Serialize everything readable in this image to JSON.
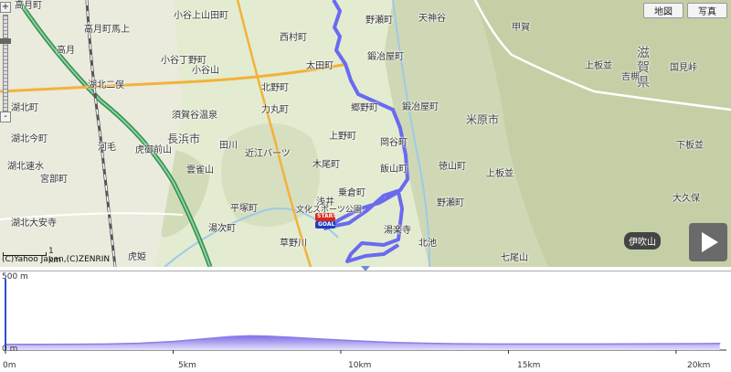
{
  "toolbar": {
    "map_label": "地図",
    "photo_label": "写真"
  },
  "map": {
    "copyright": "(C)Yahoo Japan,(C)ZENRIN",
    "scale_label": "1 km",
    "peak_label": "伊吹山",
    "zoom_plus": "+",
    "zoom_minus": "-",
    "route_color": "#6a6af0",
    "start_label": "START",
    "goal_label": "GOAL",
    "labels": [
      "高月町馬上",
      "高月町",
      "高月",
      "小谷上山田町",
      "西村町",
      "野瀬町",
      "天神谷",
      "湖北二俣",
      "小谷山",
      "太田町",
      "鍛冶屋町",
      "甲賀",
      "湖北町",
      "須賀谷温泉",
      "北野町",
      "力丸町",
      "郷野町",
      "鍛冶屋町",
      "米原市",
      "吉槻",
      "上板並",
      "国見峠",
      "虎姫",
      "河毛",
      "湖北今町",
      "長浜市",
      "田川",
      "近江バーツ",
      "岡谷町",
      "下板並",
      "湖北速水",
      "虎御前山",
      "雲雀山",
      "上野町",
      "木尾町",
      "飯山町",
      "徳山町",
      "湖北大安寺",
      "乗倉町",
      "野瀬町",
      "上板並",
      "大久保",
      "平塚町",
      "草野川",
      "浅井",
      "文化スポーツ公園",
      "湯次町",
      "北池",
      "湯楽寺",
      "七尾山",
      "宮部町",
      "小谷丁野町"
    ],
    "pref_label": "滋賀県"
  },
  "profile": {
    "y_top_label": "500 m",
    "y_bottom_label": "0 m",
    "x_ticks": [
      "0m",
      "5km",
      "10km",
      "15km",
      "20km"
    ]
  },
  "chart_data": {
    "type": "area",
    "title": "",
    "xlabel": "",
    "ylabel": "",
    "xlim": [
      0,
      21.5
    ],
    "ylim": [
      0,
      500
    ],
    "x_unit": "km",
    "y_unit": "m",
    "x": [
      0,
      1,
      2,
      3,
      4,
      5,
      6,
      6.7,
      7.3,
      7.8,
      8.5,
      9.5,
      10.5,
      11.5,
      12.5,
      13.5,
      14.5,
      15.5,
      16.5,
      17.5,
      18.5,
      19.5,
      20.5,
      21.3
    ],
    "series": [
      {
        "values": [
          40,
          40,
          41,
          42,
          48,
          60,
          80,
          95,
          100,
          98,
          90,
          76,
          64,
          54,
          48,
          44,
          42,
          42,
          42,
          42,
          43,
          44,
          45,
          46
        ]
      }
    ],
    "color": "#8b7fe8"
  }
}
